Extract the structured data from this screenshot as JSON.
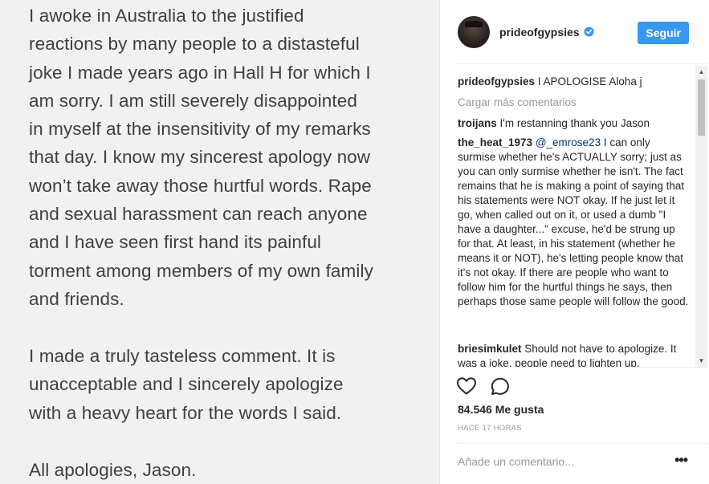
{
  "post_image": {
    "paragraphs": [
      "I awoke in Australia to the justified\nreactions by many people to a distasteful\njoke I made years ago in Hall H for which I\nam sorry.  I am still severely disappointed\nin myself at the insensitivity of my remarks\nthat day. I know my sincerest apology now\nwon’t take away those hurtful words. Rape\nand sexual harassment can reach anyone\nand I have seen first hand its painful\ntorment among members of my own family\nand friends.",
      "I made a truly tasteless comment.  It is\nunacceptable and I sincerely apologize\nwith a heavy heart for the words I said.",
      "All apologies, Jason."
    ]
  },
  "header": {
    "username": "prideofgypsies",
    "follow_label": "Seguir"
  },
  "comments": {
    "caption": {
      "user": "prideofgypsies",
      "text": "I APOLOGISE Aloha j"
    },
    "load_more": "Cargar más comentarios",
    "items": [
      {
        "user": "troijans",
        "text": "I'm restanning thank you Jason"
      },
      {
        "user": "the_heat_1973",
        "mention": "@_emrose23",
        "text": "I can only surmise whether he's ACTUALLY sorry; just as you can only surmise whether he isn't. The fact remains that he is making a point of saying that his statements were NOT okay. If he just let it go, when called out on it, or used a dumb \"I have a daughter...\" excuse, he'd be strung up for that. At least, in his statement (whether he means it or NOT), he's letting people know that it's not okay. If there are people who want to follow him for the hurtful things he says, then perhaps those same people will follow the good."
      },
      {
        "user": "briesimkulet",
        "text": "Should not have to apologize. It was a joke, people need to lighten up."
      }
    ]
  },
  "actions": {
    "likes": "84.546 Me gusta",
    "timestamp": "HACE 17 HORAS"
  },
  "comment_bar": {
    "placeholder": "Añade un comentario...",
    "more_label": "•••"
  },
  "icons": {
    "verified": "verified-badge-icon",
    "like": "heart-icon",
    "comment": "comment-bubble-icon",
    "more": "more-options-icon"
  },
  "colors": {
    "accent": "#3897f0",
    "text": "#262626",
    "muted": "#999999",
    "image_bg": "#f1f1f1"
  }
}
